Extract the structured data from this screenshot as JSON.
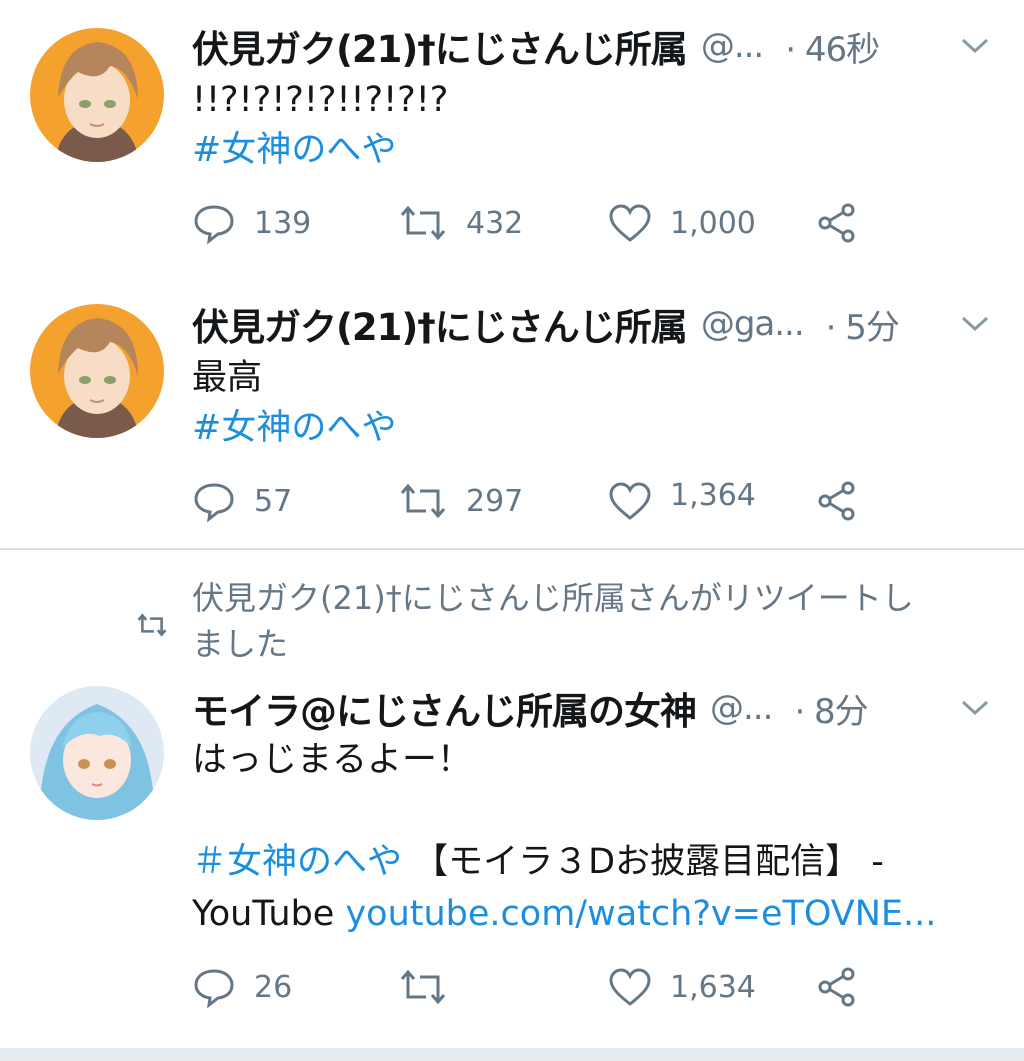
{
  "tweets": [
    {
      "name": "伏見ガク(21)†にじさんじ所属",
      "handle": "@...",
      "time": "· 46秒",
      "text": "!!?!?!?!?!!?!?!?",
      "hashtag": "#女神のへや",
      "replies": "139",
      "retweets": "432",
      "likes": "1,000",
      "avatar_bg": "#f4a12e"
    },
    {
      "name": "伏見ガク(21)†にじさんじ所属",
      "handle": "@ga...",
      "time": "· 5分",
      "text": "最高",
      "hashtag": "#女神のへや",
      "replies": "57",
      "retweets": "297",
      "likes": "1,364",
      "avatar_bg": "#f4a12e"
    },
    {
      "retweet_context_line1": "伏見ガク(21)†にじさんじ所属さんがリツイートし",
      "retweet_context_line2": "ました",
      "name": "モイラ@にじさんじ所属の女神",
      "handle": "@...",
      "time": "· 8分",
      "text": "はっじまるよー！",
      "hashtag": "＃女神のへや",
      "link_title": "【モイラ３Dお披露目配信】 -",
      "link_title2": "YouTube",
      "link_url": "youtube.com/watch?v=eTOVNE...",
      "replies": "26",
      "retweets": "",
      "likes": "1,634",
      "avatar_bg": "#dfe9f3"
    }
  ],
  "colors": {
    "accent": "#1b8ee0",
    "muted": "#657786"
  }
}
